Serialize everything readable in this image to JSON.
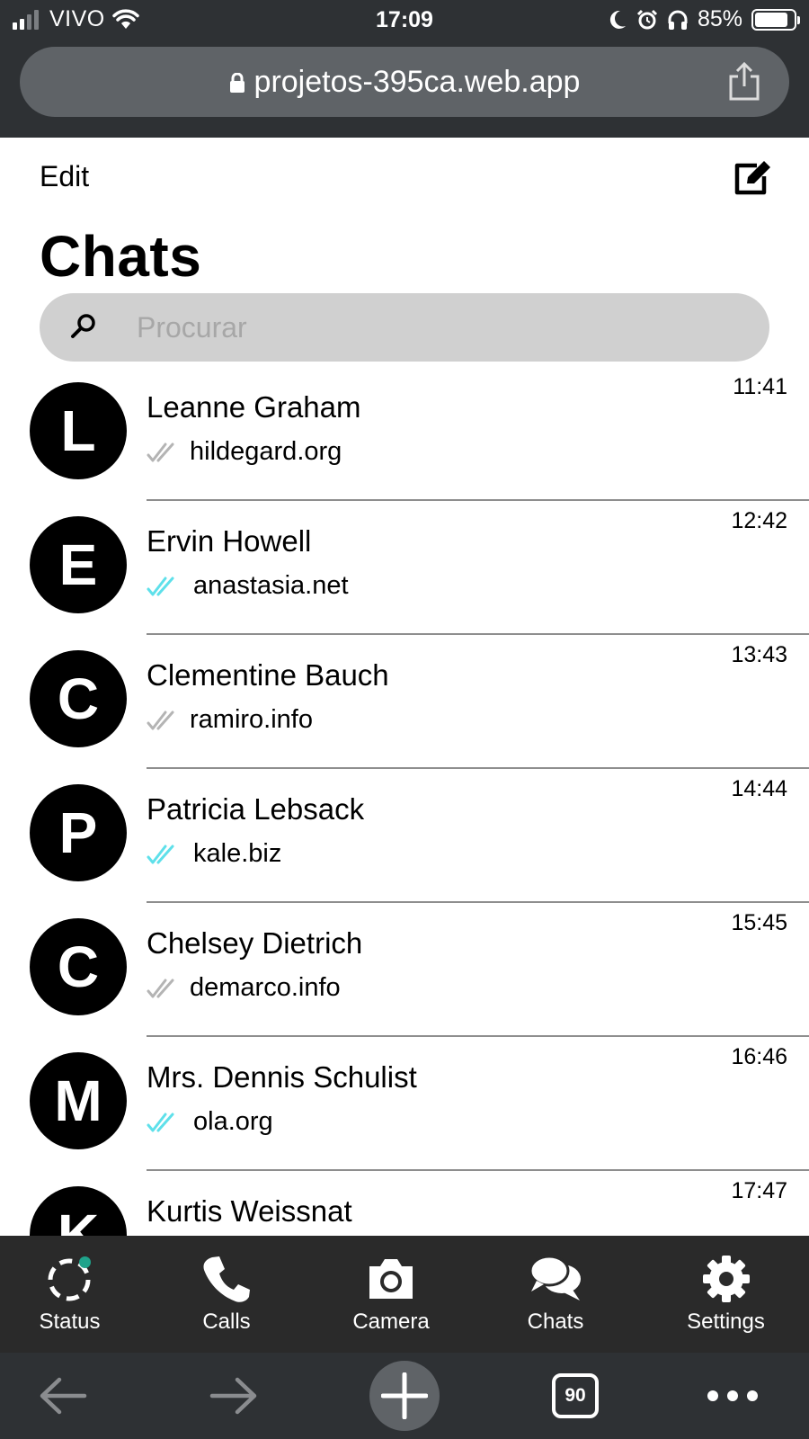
{
  "status_bar": {
    "carrier": "VIVO",
    "time": "17:09",
    "battery": "85%",
    "battery_level": 0.85,
    "icons": [
      "signal-icon",
      "wifi-icon",
      "moon-icon",
      "alarm-icon",
      "headphones-icon",
      "battery-icon"
    ]
  },
  "browser": {
    "url": "projetos-395ca.web.app",
    "tab_count": "90",
    "icons": [
      "lock-icon",
      "share-icon",
      "back-arrow-icon",
      "forward-arrow-icon",
      "plus-icon",
      "tabs-icon",
      "more-icon"
    ]
  },
  "header": {
    "edit_label": "Edit",
    "title": "Chats",
    "compose_icon": "compose-icon"
  },
  "search": {
    "placeholder": "Procurar",
    "value": ""
  },
  "chats": [
    {
      "initial": "L",
      "name": "Leanne Graham",
      "preview": "hildegard.org",
      "time": "11:41",
      "read": false
    },
    {
      "initial": "E",
      "name": "Ervin Howell",
      "preview": "anastasia.net",
      "time": "12:42",
      "read": true
    },
    {
      "initial": "C",
      "name": "Clementine Bauch",
      "preview": "ramiro.info",
      "time": "13:43",
      "read": false
    },
    {
      "initial": "P",
      "name": "Patricia Lebsack",
      "preview": "kale.biz",
      "time": "14:44",
      "read": true
    },
    {
      "initial": "C",
      "name": "Chelsey Dietrich",
      "preview": "demarco.info",
      "time": "15:45",
      "read": false
    },
    {
      "initial": "M",
      "name": "Mrs. Dennis Schulist",
      "preview": "ola.org",
      "time": "16:46",
      "read": true
    },
    {
      "initial": "K",
      "name": "Kurtis Weissnat",
      "preview": "",
      "time": "17:47",
      "read": false
    }
  ],
  "tabs": [
    {
      "label": "Status",
      "icon": "status-icon"
    },
    {
      "label": "Calls",
      "icon": "phone-icon"
    },
    {
      "label": "Camera",
      "icon": "camera-icon"
    },
    {
      "label": "Chats",
      "icon": "chat-bubbles-icon"
    },
    {
      "label": "Settings",
      "icon": "gear-icon"
    }
  ],
  "colors": {
    "read_ticks": "#5ee0ea",
    "unread_ticks": "#b4b4b4",
    "status_dot": "#1fa38b",
    "tab_bar": "#2a2a2a",
    "browser_chrome": "#2e3134"
  }
}
